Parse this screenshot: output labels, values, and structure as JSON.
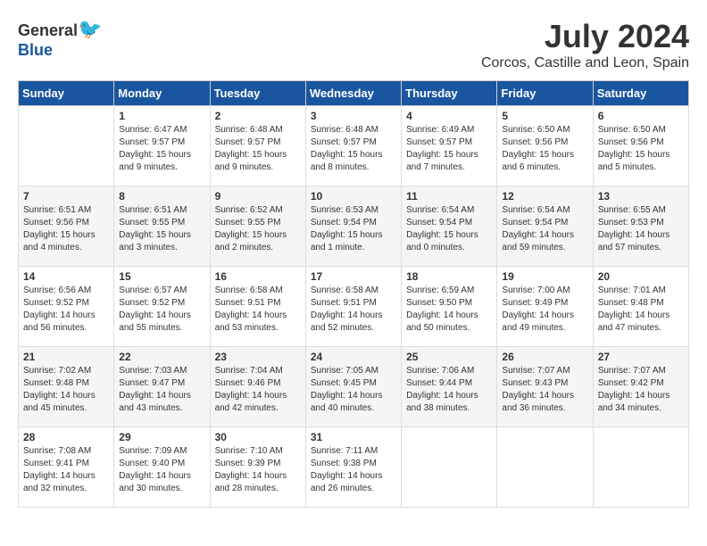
{
  "header": {
    "logo_general": "General",
    "logo_blue": "Blue",
    "month_year": "July 2024",
    "location": "Corcos, Castille and Leon, Spain"
  },
  "days_of_week": [
    "Sunday",
    "Monday",
    "Tuesday",
    "Wednesday",
    "Thursday",
    "Friday",
    "Saturday"
  ],
  "weeks": [
    [
      {
        "day": "",
        "info": ""
      },
      {
        "day": "1",
        "info": "Sunrise: 6:47 AM\nSunset: 9:57 PM\nDaylight: 15 hours\nand 9 minutes."
      },
      {
        "day": "2",
        "info": "Sunrise: 6:48 AM\nSunset: 9:57 PM\nDaylight: 15 hours\nand 9 minutes."
      },
      {
        "day": "3",
        "info": "Sunrise: 6:48 AM\nSunset: 9:57 PM\nDaylight: 15 hours\nand 8 minutes."
      },
      {
        "day": "4",
        "info": "Sunrise: 6:49 AM\nSunset: 9:57 PM\nDaylight: 15 hours\nand 7 minutes."
      },
      {
        "day": "5",
        "info": "Sunrise: 6:50 AM\nSunset: 9:56 PM\nDaylight: 15 hours\nand 6 minutes."
      },
      {
        "day": "6",
        "info": "Sunrise: 6:50 AM\nSunset: 9:56 PM\nDaylight: 15 hours\nand 5 minutes."
      }
    ],
    [
      {
        "day": "7",
        "info": "Sunrise: 6:51 AM\nSunset: 9:56 PM\nDaylight: 15 hours\nand 4 minutes."
      },
      {
        "day": "8",
        "info": "Sunrise: 6:51 AM\nSunset: 9:55 PM\nDaylight: 15 hours\nand 3 minutes."
      },
      {
        "day": "9",
        "info": "Sunrise: 6:52 AM\nSunset: 9:55 PM\nDaylight: 15 hours\nand 2 minutes."
      },
      {
        "day": "10",
        "info": "Sunrise: 6:53 AM\nSunset: 9:54 PM\nDaylight: 15 hours\nand 1 minute."
      },
      {
        "day": "11",
        "info": "Sunrise: 6:54 AM\nSunset: 9:54 PM\nDaylight: 15 hours\nand 0 minutes."
      },
      {
        "day": "12",
        "info": "Sunrise: 6:54 AM\nSunset: 9:54 PM\nDaylight: 14 hours\nand 59 minutes."
      },
      {
        "day": "13",
        "info": "Sunrise: 6:55 AM\nSunset: 9:53 PM\nDaylight: 14 hours\nand 57 minutes."
      }
    ],
    [
      {
        "day": "14",
        "info": "Sunrise: 6:56 AM\nSunset: 9:52 PM\nDaylight: 14 hours\nand 56 minutes."
      },
      {
        "day": "15",
        "info": "Sunrise: 6:57 AM\nSunset: 9:52 PM\nDaylight: 14 hours\nand 55 minutes."
      },
      {
        "day": "16",
        "info": "Sunrise: 6:58 AM\nSunset: 9:51 PM\nDaylight: 14 hours\nand 53 minutes."
      },
      {
        "day": "17",
        "info": "Sunrise: 6:58 AM\nSunset: 9:51 PM\nDaylight: 14 hours\nand 52 minutes."
      },
      {
        "day": "18",
        "info": "Sunrise: 6:59 AM\nSunset: 9:50 PM\nDaylight: 14 hours\nand 50 minutes."
      },
      {
        "day": "19",
        "info": "Sunrise: 7:00 AM\nSunset: 9:49 PM\nDaylight: 14 hours\nand 49 minutes."
      },
      {
        "day": "20",
        "info": "Sunrise: 7:01 AM\nSunset: 9:48 PM\nDaylight: 14 hours\nand 47 minutes."
      }
    ],
    [
      {
        "day": "21",
        "info": "Sunrise: 7:02 AM\nSunset: 9:48 PM\nDaylight: 14 hours\nand 45 minutes."
      },
      {
        "day": "22",
        "info": "Sunrise: 7:03 AM\nSunset: 9:47 PM\nDaylight: 14 hours\nand 43 minutes."
      },
      {
        "day": "23",
        "info": "Sunrise: 7:04 AM\nSunset: 9:46 PM\nDaylight: 14 hours\nand 42 minutes."
      },
      {
        "day": "24",
        "info": "Sunrise: 7:05 AM\nSunset: 9:45 PM\nDaylight: 14 hours\nand 40 minutes."
      },
      {
        "day": "25",
        "info": "Sunrise: 7:06 AM\nSunset: 9:44 PM\nDaylight: 14 hours\nand 38 minutes."
      },
      {
        "day": "26",
        "info": "Sunrise: 7:07 AM\nSunset: 9:43 PM\nDaylight: 14 hours\nand 36 minutes."
      },
      {
        "day": "27",
        "info": "Sunrise: 7:07 AM\nSunset: 9:42 PM\nDaylight: 14 hours\nand 34 minutes."
      }
    ],
    [
      {
        "day": "28",
        "info": "Sunrise: 7:08 AM\nSunset: 9:41 PM\nDaylight: 14 hours\nand 32 minutes."
      },
      {
        "day": "29",
        "info": "Sunrise: 7:09 AM\nSunset: 9:40 PM\nDaylight: 14 hours\nand 30 minutes."
      },
      {
        "day": "30",
        "info": "Sunrise: 7:10 AM\nSunset: 9:39 PM\nDaylight: 14 hours\nand 28 minutes."
      },
      {
        "day": "31",
        "info": "Sunrise: 7:11 AM\nSunset: 9:38 PM\nDaylight: 14 hours\nand 26 minutes."
      },
      {
        "day": "",
        "info": ""
      },
      {
        "day": "",
        "info": ""
      },
      {
        "day": "",
        "info": ""
      }
    ]
  ]
}
